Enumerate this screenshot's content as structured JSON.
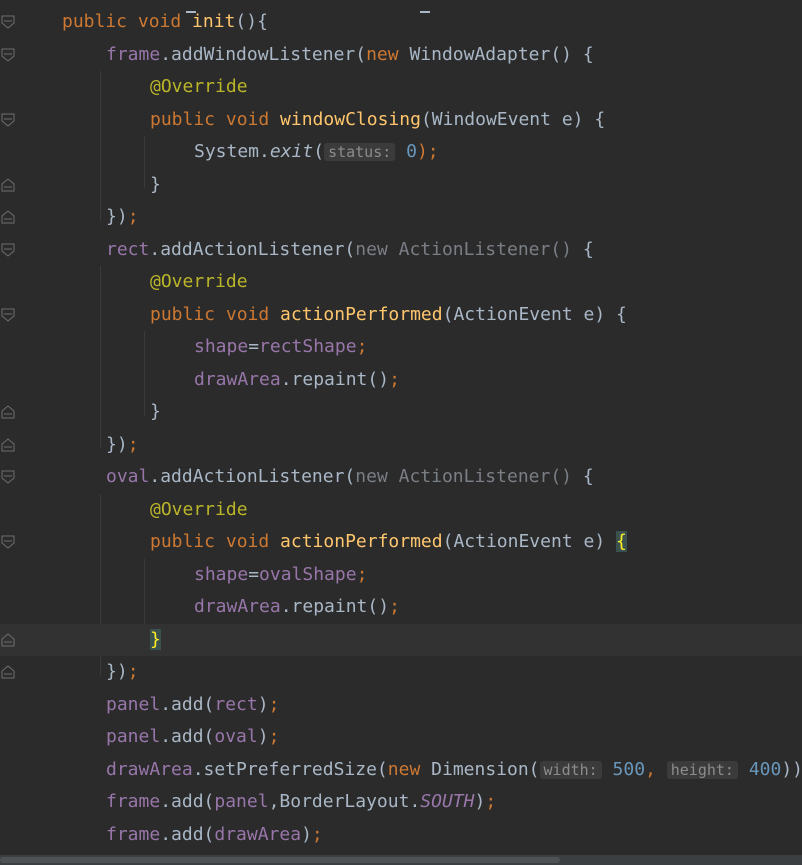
{
  "editor": {
    "lines": [
      [
        {
          "t": "public void ",
          "c": "kw"
        },
        {
          "t": "init",
          "c": "fn"
        },
        {
          "t": "(){",
          "c": ""
        }
      ],
      [
        {
          "t": "frame",
          "c": "fld"
        },
        {
          "t": ".addWindowListener(",
          "c": ""
        },
        {
          "t": "new ",
          "c": "kw"
        },
        {
          "t": "WindowAdapter() {",
          "c": ""
        }
      ],
      [
        {
          "t": "@Override",
          "c": "ann"
        }
      ],
      [
        {
          "t": "public void ",
          "c": "kw"
        },
        {
          "t": "windowClosing",
          "c": "fn"
        },
        {
          "t": "(WindowEvent e) {",
          "c": ""
        }
      ],
      [
        {
          "t": "System.",
          "c": ""
        },
        {
          "t": "exit",
          "c": "it"
        },
        {
          "t": "(",
          "c": ""
        },
        {
          "t": "status:",
          "c": "hint"
        },
        {
          "t": " ",
          "c": ""
        },
        {
          "t": "0",
          "c": "num"
        },
        {
          "t": ");",
          "c": "kw"
        }
      ],
      [
        {
          "t": "}",
          "c": ""
        }
      ],
      [
        {
          "t": "})",
          "c": ""
        },
        {
          "t": ";",
          "c": "kw"
        }
      ],
      [
        {
          "t": "rect",
          "c": "fld"
        },
        {
          "t": ".addActionListener(",
          "c": ""
        },
        {
          "t": "new ActionListener() ",
          "c": "dim"
        },
        {
          "t": "{",
          "c": ""
        }
      ],
      [
        {
          "t": "@Override",
          "c": "ann"
        }
      ],
      [
        {
          "t": "public void ",
          "c": "kw"
        },
        {
          "t": "actionPerformed",
          "c": "fn"
        },
        {
          "t": "(ActionEvent e) {",
          "c": ""
        }
      ],
      [
        {
          "t": "shape",
          "c": "fld"
        },
        {
          "t": "=",
          "c": ""
        },
        {
          "t": "rectShape",
          "c": "fld"
        },
        {
          "t": ";",
          "c": "kw"
        }
      ],
      [
        {
          "t": "drawArea",
          "c": "fld"
        },
        {
          "t": ".repaint()",
          "c": ""
        },
        {
          "t": ";",
          "c": "kw"
        }
      ],
      [
        {
          "t": "}",
          "c": ""
        }
      ],
      [
        {
          "t": "})",
          "c": ""
        },
        {
          "t": ";",
          "c": "kw"
        }
      ],
      [
        {
          "t": "oval",
          "c": "fld"
        },
        {
          "t": ".addActionListener(",
          "c": ""
        },
        {
          "t": "new ActionListener() ",
          "c": "dim"
        },
        {
          "t": "{",
          "c": ""
        }
      ],
      [
        {
          "t": "@Override",
          "c": "ann"
        }
      ],
      [
        {
          "t": "public void ",
          "c": "kw"
        },
        {
          "t": "actionPerformed",
          "c": "fn"
        },
        {
          "t": "(ActionEvent e) ",
          "c": ""
        },
        {
          "t": "{",
          "c": "brace-hl"
        }
      ],
      [
        {
          "t": "shape",
          "c": "fld"
        },
        {
          "t": "=",
          "c": ""
        },
        {
          "t": "ovalShape",
          "c": "fld"
        },
        {
          "t": ";",
          "c": "kw"
        }
      ],
      [
        {
          "t": "drawArea",
          "c": "fld"
        },
        {
          "t": ".repaint()",
          "c": ""
        },
        {
          "t": ";",
          "c": "kw"
        }
      ],
      [
        {
          "t": "}",
          "c": "brace-hl2"
        }
      ],
      [
        {
          "t": "})",
          "c": ""
        },
        {
          "t": ";",
          "c": "kw"
        }
      ],
      [
        {
          "t": "panel",
          "c": "fld"
        },
        {
          "t": ".add(",
          "c": ""
        },
        {
          "t": "rect",
          "c": "fld"
        },
        {
          "t": ")",
          "c": ""
        },
        {
          "t": ";",
          "c": "kw"
        }
      ],
      [
        {
          "t": "panel",
          "c": "fld"
        },
        {
          "t": ".add(",
          "c": ""
        },
        {
          "t": "oval",
          "c": "fld"
        },
        {
          "t": ")",
          "c": ""
        },
        {
          "t": ";",
          "c": "kw"
        }
      ],
      [
        {
          "t": "drawArea",
          "c": "fld"
        },
        {
          "t": ".setPreferredSize(",
          "c": ""
        },
        {
          "t": "new ",
          "c": "kw"
        },
        {
          "t": "Dimension(",
          "c": ""
        },
        {
          "t": "width:",
          "c": "hint"
        },
        {
          "t": " ",
          "c": ""
        },
        {
          "t": "500",
          "c": "num"
        },
        {
          "t": ", ",
          "c": "kw"
        },
        {
          "t": "height:",
          "c": "hint"
        },
        {
          "t": " ",
          "c": ""
        },
        {
          "t": "400",
          "c": "num"
        },
        {
          "t": "))",
          "c": ""
        },
        {
          "t": ";",
          "c": "kw"
        }
      ],
      [
        {
          "t": "frame",
          "c": "fld"
        },
        {
          "t": ".add(",
          "c": ""
        },
        {
          "t": "panel",
          "c": "fld"
        },
        {
          "t": ",BorderLayout.",
          "c": ""
        },
        {
          "t": "SOUTH",
          "c": "fld it"
        },
        {
          "t": ")",
          "c": ""
        },
        {
          "t": ";",
          "c": "kw"
        }
      ],
      [
        {
          "t": "frame",
          "c": "fld"
        },
        {
          "t": ".add(",
          "c": ""
        },
        {
          "t": "drawArea",
          "c": "fld"
        },
        {
          "t": ")",
          "c": ""
        },
        {
          "t": ";",
          "c": "kw"
        }
      ]
    ],
    "current_line_index": 19,
    "colors": {
      "background": "#2b2b2b",
      "keyword": "#cc7832",
      "function": "#ffc66d",
      "field": "#9876aa",
      "annotation": "#bbb529",
      "number": "#6897bb",
      "plain": "#a9b7c6"
    }
  }
}
